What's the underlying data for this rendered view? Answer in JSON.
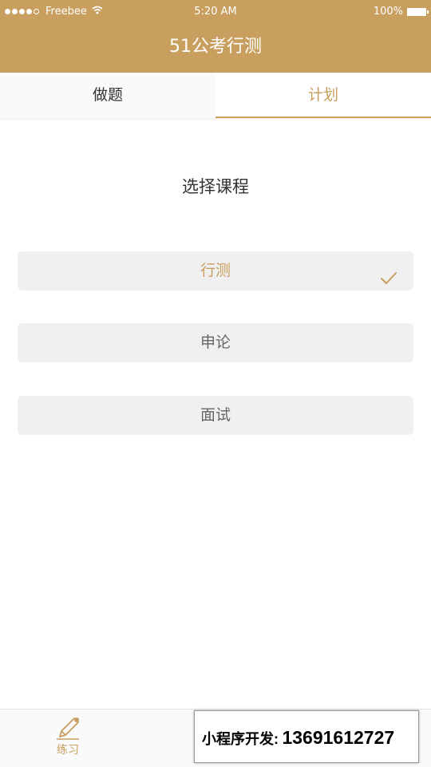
{
  "status_bar": {
    "carrier": "Freebee",
    "time": "5:20 AM",
    "battery": "100%",
    "signal_bars": 4,
    "signal_total": 5
  },
  "nav": {
    "title": "51公考行测"
  },
  "tabs": [
    {
      "label": "做题",
      "active": false
    },
    {
      "label": "计划",
      "active": true
    }
  ],
  "section_title": "选择课程",
  "options": [
    {
      "label": "行测",
      "selected": true
    },
    {
      "label": "申论",
      "selected": false
    },
    {
      "label": "面试",
      "selected": false
    }
  ],
  "tabbar": {
    "items": [
      {
        "label": "练习",
        "icon": "pencil-icon"
      }
    ]
  },
  "promo": {
    "label": "小程序开发:",
    "phone": "13691612727"
  },
  "colors": {
    "accent": "#c89f5f",
    "option_bg": "#f0f0f0"
  }
}
